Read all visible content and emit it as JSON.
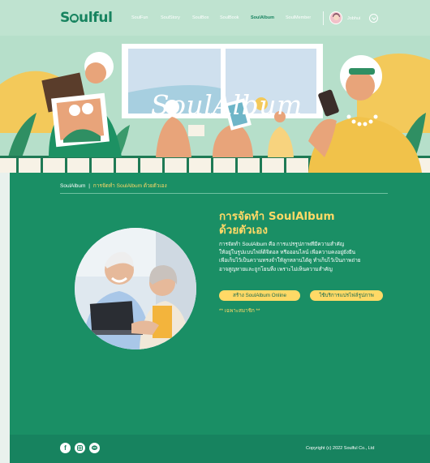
{
  "header": {
    "logo": "Soulful",
    "nav": [
      {
        "label": "SoulFun",
        "active": false
      },
      {
        "label": "SoulStory",
        "active": false
      },
      {
        "label": "SoulBox",
        "active": false
      },
      {
        "label": "SoulBook",
        "active": false
      },
      {
        "label": "SoulAlbum",
        "active": true
      },
      {
        "label": "SoulMember",
        "active": false
      }
    ],
    "user_name": "Jobhui"
  },
  "banner": {
    "title": "SoulAlbum"
  },
  "breadcrumb": {
    "root": "SoulAlbum",
    "separator": "|",
    "current": "การจัดทำ SoulAlbum ด้วยตัวเอง"
  },
  "main": {
    "title_line1": "การจัดทำ SoulAlbum",
    "title_line2": "ด้วยตัวเอง",
    "description": [
      "การจัดทำ SoulAlbum คือ การแปรรูปภาพที่มีความสำคัญ",
      "ให้อยู่ในรูปแบบไฟล์ดิจิตอล หรือออนไลน์ เพื่อความคงอยู่ยั่งยืน",
      "เพื่อเก็บไว้เป็นความทรงจำให้ลูกหลานได้ดู ทำเก็บไว้เป็นภาพถ่าย",
      "อาจสูญหายและถูกโยนทิ้ง เพราะไม่เห็นความสำคัญ"
    ],
    "button_primary": "สร้าง SoulAlbum Online",
    "button_secondary": "ใช้บริการแปรไฟล์รูปภาพ",
    "note": "** เฉพาะสมาชิก **"
  },
  "footer": {
    "social_icons": [
      "facebook-icon",
      "instagram-icon",
      "line-icon"
    ],
    "copyright": "Copyright (c) 2022 Soulful Co., Ltd"
  },
  "colors": {
    "brand_green": "#17835f",
    "content_green": "#1a8f65",
    "header_mint": "#bfe3d0",
    "accent_yellow": "#ffd966"
  }
}
